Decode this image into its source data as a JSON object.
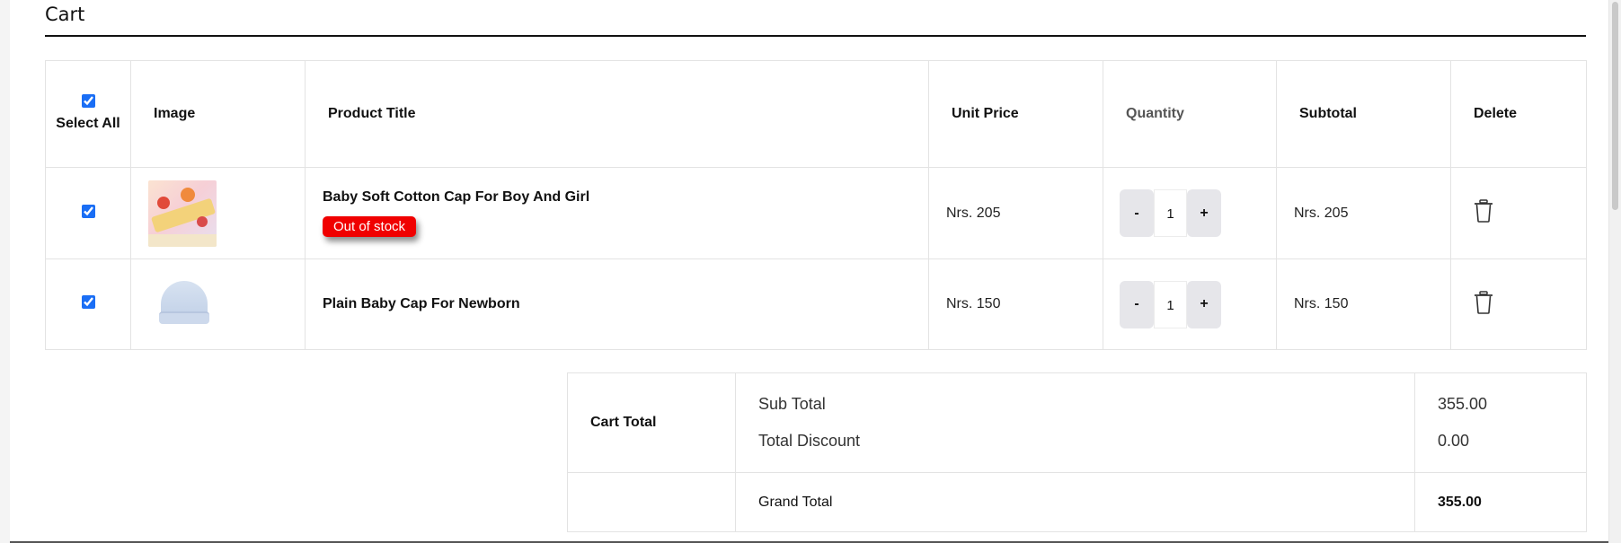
{
  "page": {
    "title": "Cart"
  },
  "table": {
    "headers": {
      "select_all": "Select All",
      "image": "Image",
      "product_title": "Product Title",
      "unit_price": "Unit Price",
      "quantity": "Quantity",
      "subtotal": "Subtotal",
      "delete": "Delete"
    },
    "select_all_checked": true,
    "rows": [
      {
        "checked": true,
        "image_icon": "baby-cap-product-thumbnail",
        "title": "Baby Soft Cotton Cap For Boy And Girl",
        "badge": "Out of stock",
        "unit_price": "Nrs. 205",
        "quantity": "1",
        "subtotal": "Nrs. 205"
      },
      {
        "checked": true,
        "image_icon": "plain-cap-product-thumbnail",
        "title": "Plain Baby Cap For Newborn",
        "badge": "",
        "unit_price": "Nrs. 150",
        "quantity": "1",
        "subtotal": "Nrs. 150"
      }
    ],
    "qty_minus_label": "-",
    "qty_plus_label": "+"
  },
  "totals": {
    "cart_total_label": "Cart Total",
    "sub_total_label": "Sub Total",
    "sub_total_value": "355.00",
    "total_discount_label": "Total Discount",
    "total_discount_value": "0.00",
    "grand_total_label": "Grand Total",
    "grand_total_value": "355.00"
  },
  "colors": {
    "badge_bg": "#f00000",
    "checkbox_accent": "#1a6ef5",
    "qty_button_bg": "#e6e6ea"
  }
}
